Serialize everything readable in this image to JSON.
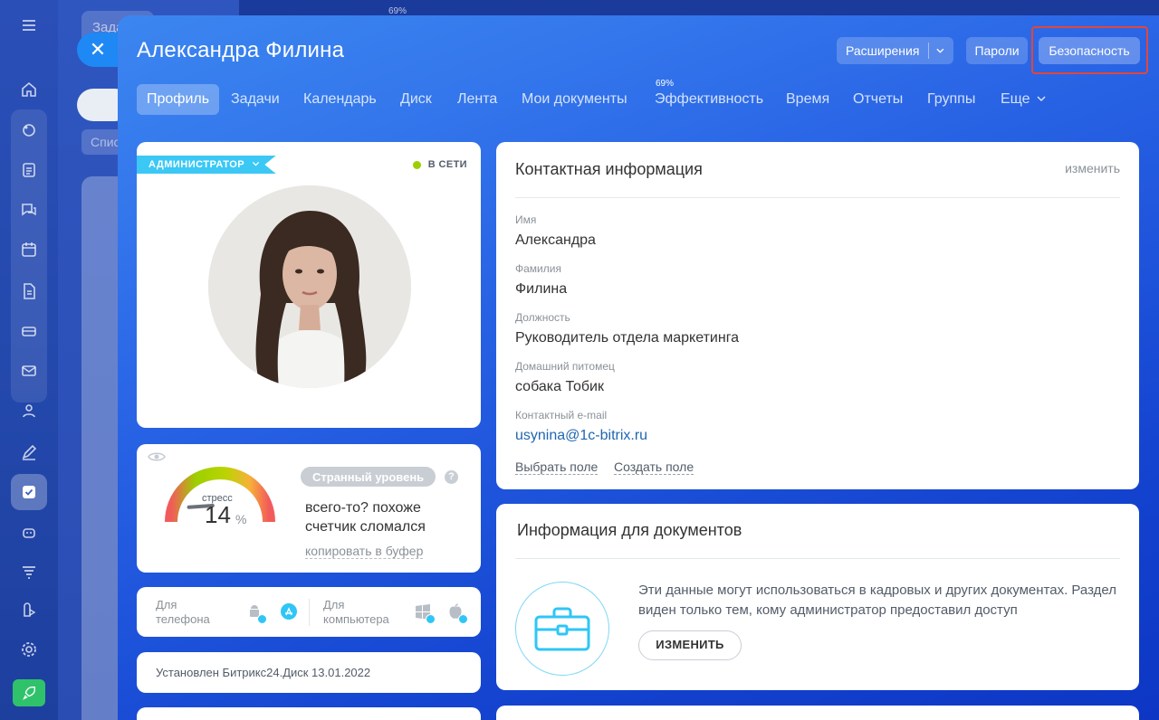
{
  "top_percent": "69%",
  "background": {
    "tab_label": "Зада",
    "chip_label": "Спис"
  },
  "sidebar": {
    "icons": [
      "menu-icon",
      "home-icon",
      "feed-icon",
      "tasks-icon",
      "chat-icon",
      "calendar-icon",
      "documents-icon",
      "crm-icon",
      "mail-icon",
      "contacts-icon",
      "sign-icon",
      "tasks-checkbox-icon",
      "bot-icon",
      "filter-icon",
      "market-icon",
      "settings-icon",
      "rocket-icon"
    ]
  },
  "header": {
    "title": "Александра Филина",
    "buttons": {
      "extensions": "Расширения",
      "passwords": "Пароли",
      "security": "Безопасность"
    }
  },
  "tabs": [
    {
      "label": "Профиль",
      "active": true
    },
    {
      "label": "Задачи"
    },
    {
      "label": "Календарь"
    },
    {
      "label": "Диск"
    },
    {
      "label": "Лента"
    },
    {
      "label": "Мои документы"
    },
    {
      "label": "Эффективность",
      "badge": "69%"
    },
    {
      "label": "Время"
    },
    {
      "label": "Отчеты"
    },
    {
      "label": "Группы"
    },
    {
      "label": "Еще"
    }
  ],
  "profile": {
    "role": "АДМИНИСТРАТОР",
    "status": "В СЕТИ"
  },
  "stress": {
    "label": "стресс",
    "value": "14",
    "unit": "%",
    "level": "Странный уровень",
    "help": "?",
    "comment": "всего-то? похоже счетчик сломался",
    "copy_link": "копировать в буфер",
    "level_fraction": 0.14
  },
  "apps": {
    "phone_label": "Для телефона",
    "computer_label": "Для компьютера",
    "phone_icons": [
      "android-icon",
      "appstore-icon"
    ],
    "computer_icons": [
      "windows-icon",
      "apple-icon"
    ]
  },
  "disk": {
    "text": "Установлен Битрикс24.Диск 13.01.2022"
  },
  "contact": {
    "title": "Контактная информация",
    "edit": "изменить",
    "fields": [
      {
        "label": "Имя",
        "value": "Александра"
      },
      {
        "label": "Фамилия",
        "value": "Филина"
      },
      {
        "label": "Должность",
        "value": "Руководитель отдела маркетинга"
      },
      {
        "label": "Домашний питомец",
        "value": "собака Тобик"
      },
      {
        "label": "Контактный e-mail",
        "value": "usynina@1c-bitrix.ru"
      }
    ],
    "select_field": "Выбрать поле",
    "create_field": "Создать поле"
  },
  "documents": {
    "title": "Информация для документов",
    "text": "Эти данные могут использоваться в кадровых и других документах. Раздел виден только тем, кому администратор предоставил доступ",
    "button": "ИЗМЕНИТЬ"
  },
  "colors": {
    "highlight": "#e2463b",
    "role_flag": "#3bc8f5",
    "online_dot": "#9dcf00",
    "link": "#2067b0"
  }
}
